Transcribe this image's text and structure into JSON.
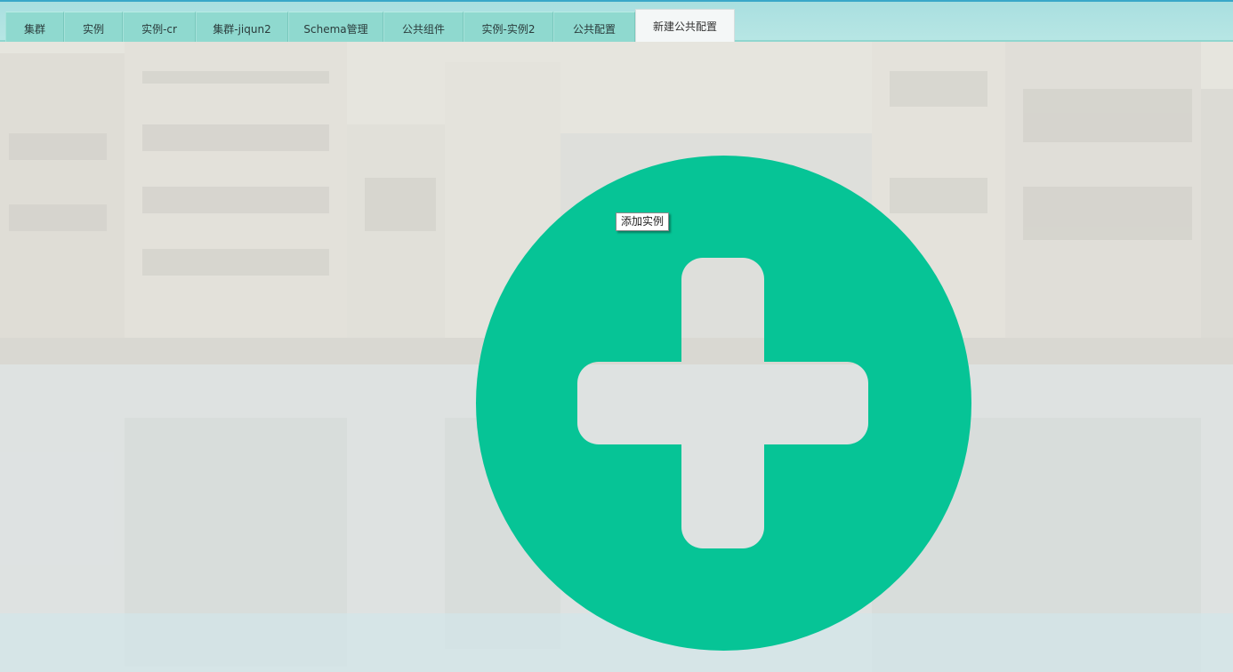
{
  "tabs": [
    {
      "label": "集群"
    },
    {
      "label": "实例"
    },
    {
      "label": "实例-cr"
    },
    {
      "label": "集群-jiqun2"
    },
    {
      "label": "Schema管理"
    },
    {
      "label": "公共组件"
    },
    {
      "label": "实例-实例2"
    },
    {
      "label": "公共配置"
    },
    {
      "label": "新建公共配置"
    }
  ],
  "add_button": {
    "icon": "plus-icon",
    "tooltip": "添加实例"
  },
  "colors": {
    "accent": "#06c496",
    "tab_bg": "#8fd9cf",
    "active_tab_bg": "#f4f7f7",
    "tabbar_border": "#3aa7c9"
  }
}
